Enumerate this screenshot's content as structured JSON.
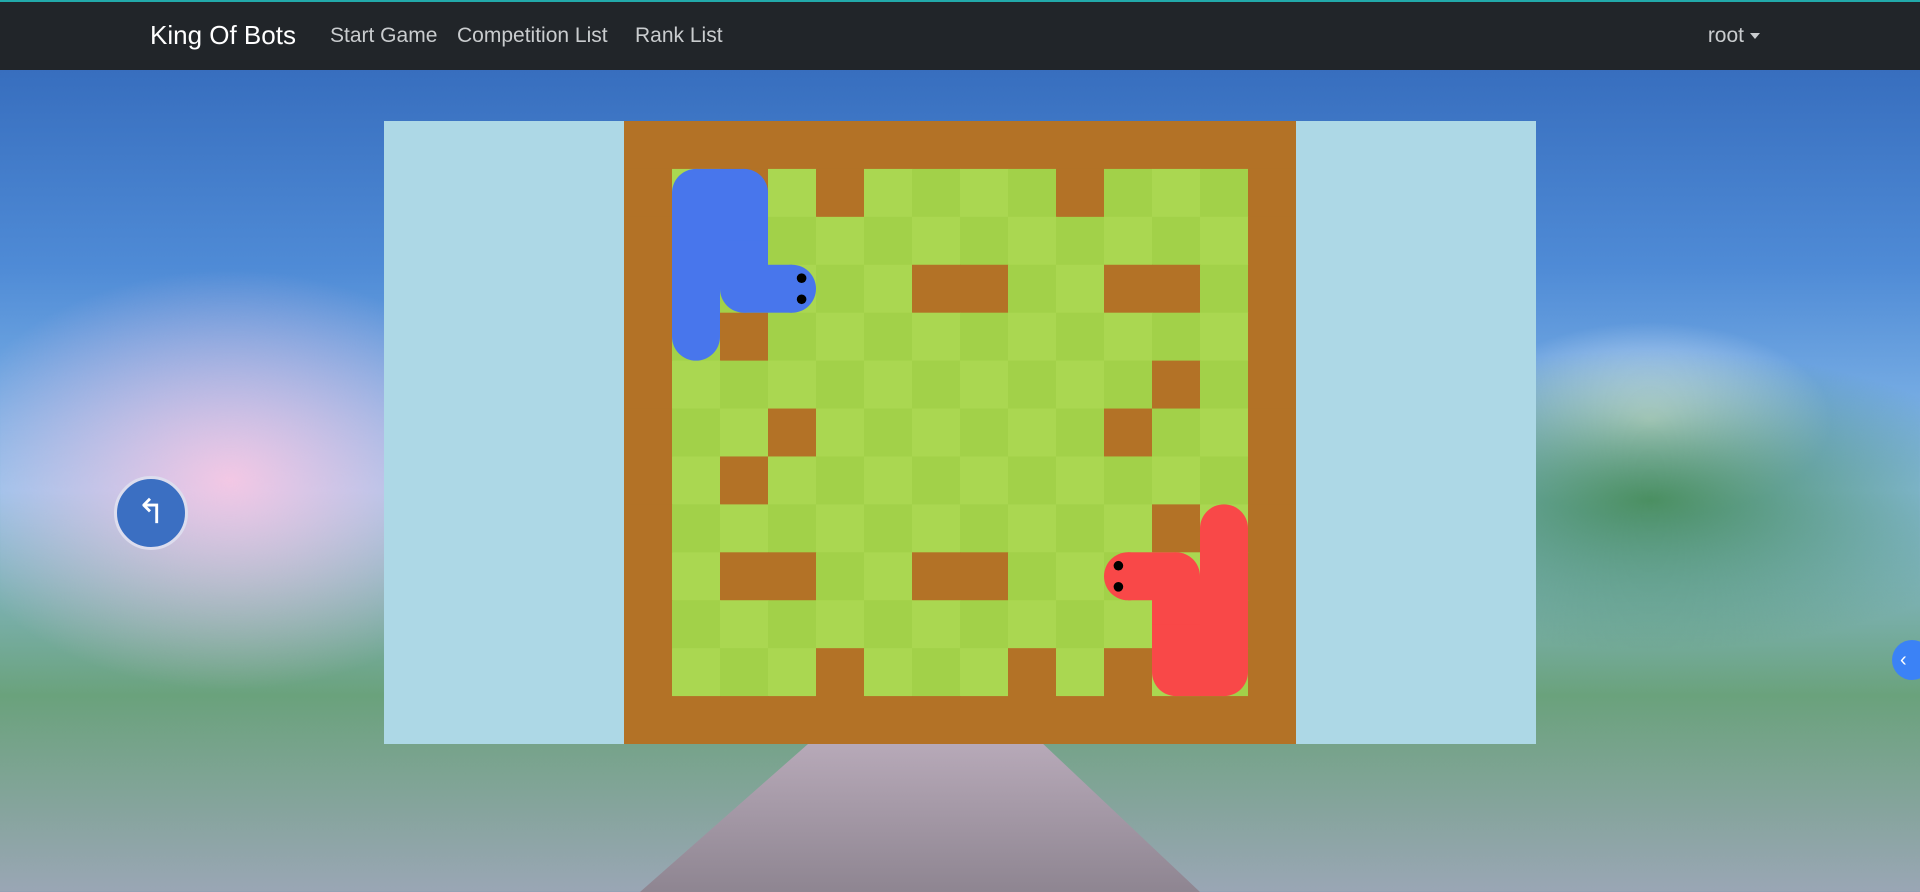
{
  "navbar": {
    "brand": "King Of Bots",
    "links": [
      "Start Game",
      "Competition List",
      "Rank List"
    ],
    "user": "root"
  },
  "colors": {
    "navbar_bg": "#212529",
    "playground_bg": "#add8e6",
    "wall": "#b37226",
    "grass_light": "#aad751",
    "grass_dark": "#a2d149",
    "snake_a": "#4876ec",
    "snake_b": "#f94848"
  },
  "game": {
    "rows": 13,
    "cols": 14,
    "inner_walls": [
      [
        1,
        2
      ],
      [
        1,
        4
      ],
      [
        1,
        9
      ],
      [
        3,
        6
      ],
      [
        3,
        7
      ],
      [
        3,
        10
      ],
      [
        3,
        11
      ],
      [
        4,
        2
      ],
      [
        5,
        11
      ],
      [
        6,
        3
      ],
      [
        6,
        10
      ],
      [
        7,
        2
      ],
      [
        8,
        11
      ],
      [
        9,
        2
      ],
      [
        9,
        3
      ],
      [
        9,
        6
      ],
      [
        9,
        7
      ],
      [
        11,
        4
      ],
      [
        11,
        8
      ],
      [
        11,
        10
      ]
    ],
    "snakes": [
      {
        "id": "a",
        "color": "#4876ec",
        "cells": [
          [
            4,
            1
          ],
          [
            3,
            1
          ],
          [
            2,
            1
          ],
          [
            1,
            1
          ],
          [
            1,
            2
          ],
          [
            2,
            2
          ],
          [
            3,
            2
          ],
          [
            3,
            3
          ]
        ],
        "head": [
          3,
          3
        ]
      },
      {
        "id": "b",
        "color": "#f94848",
        "cells": [
          [
            8,
            12
          ],
          [
            9,
            12
          ],
          [
            10,
            12
          ],
          [
            11,
            12
          ],
          [
            11,
            11
          ],
          [
            10,
            11
          ],
          [
            9,
            11
          ],
          [
            9,
            10
          ]
        ],
        "head": [
          9,
          10
        ]
      }
    ]
  },
  "sidebar_toggle_icon": "chevron-left-icon"
}
